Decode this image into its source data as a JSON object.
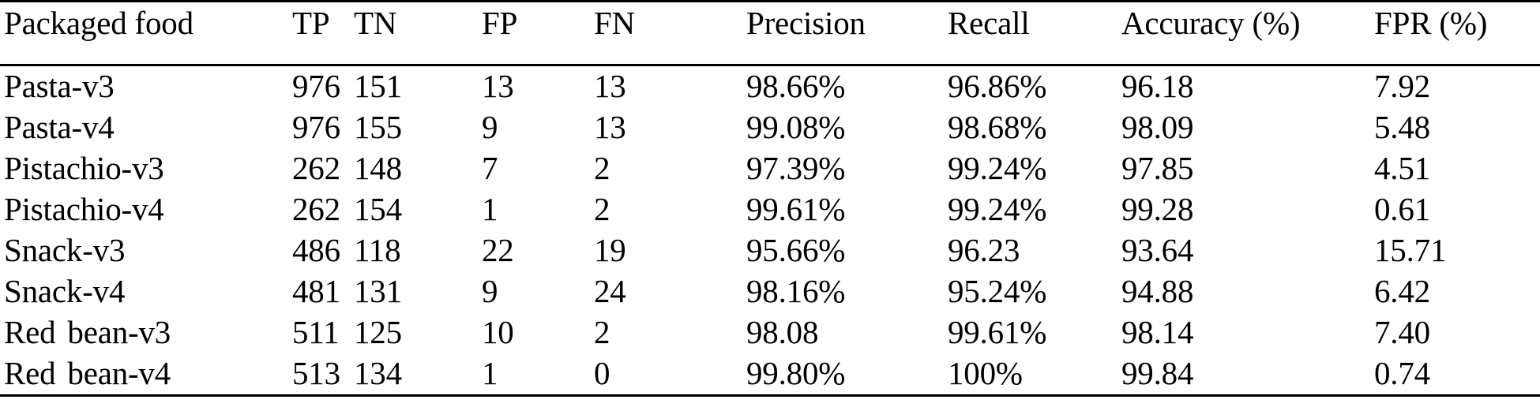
{
  "table": {
    "caption_present": false,
    "columns": [
      {
        "key": "name",
        "label": "Packaged food"
      },
      {
        "key": "tp",
        "label": "TP"
      },
      {
        "key": "tn",
        "label": "TN"
      },
      {
        "key": "fp",
        "label": "FP"
      },
      {
        "key": "fn",
        "label": "FN"
      },
      {
        "key": "precision",
        "label": "Precision"
      },
      {
        "key": "recall",
        "label": "Recall"
      },
      {
        "key": "accuracy",
        "label": "Accuracy (%)"
      },
      {
        "key": "fpr",
        "label": "FPR (%)"
      }
    ],
    "rows": [
      {
        "name": "Pasta-v3",
        "tp": "976",
        "tn": "151",
        "fp": "13",
        "fn": "13",
        "precision": "98.66%",
        "recall": "96.86%",
        "accuracy": "96.18",
        "fpr": "7.92"
      },
      {
        "name": "Pasta-v4",
        "tp": "976",
        "tn": "155",
        "fp": "9",
        "fn": "13",
        "precision": "99.08%",
        "recall": "98.68%",
        "accuracy": "98.09",
        "fpr": "5.48"
      },
      {
        "name": "Pistachio-v3",
        "tp": "262",
        "tn": "148",
        "fp": "7",
        "fn": "2",
        "precision": "97.39%",
        "recall": "99.24%",
        "accuracy": "97.85",
        "fpr": "4.51"
      },
      {
        "name": "Pistachio-v4",
        "tp": "262",
        "tn": "154",
        "fp": "1",
        "fn": "2",
        "precision": "99.61%",
        "recall": "99.24%",
        "accuracy": "99.28",
        "fpr": "0.61"
      },
      {
        "name": "Snack-v3",
        "tp": "486",
        "tn": "118",
        "fp": "22",
        "fn": "19",
        "precision": "95.66%",
        "recall": "96.23",
        "accuracy": "93.64",
        "fpr": "15.71"
      },
      {
        "name": "Snack-v4",
        "tp": "481",
        "tn": "131",
        "fp": "9",
        "fn": "24",
        "precision": "98.16%",
        "recall": "95.24%",
        "accuracy": "94.88",
        "fpr": "6.42"
      },
      {
        "name": "Red bean-v3",
        "tp": "511",
        "tn": "125",
        "fp": "10",
        "fn": "2",
        "precision": "98.08",
        "recall": "99.61%",
        "accuracy": "98.14",
        "fpr": "7.40"
      },
      {
        "name": "Red bean-v4",
        "tp": "513",
        "tn": "134",
        "fp": "1",
        "fn": "0",
        "precision": "99.80%",
        "recall": "100%",
        "accuracy": "99.84",
        "fpr": "0.74"
      }
    ]
  },
  "style": {
    "text_color": "#000000",
    "background_color": "#ffffff",
    "rule_color": "#000000"
  }
}
